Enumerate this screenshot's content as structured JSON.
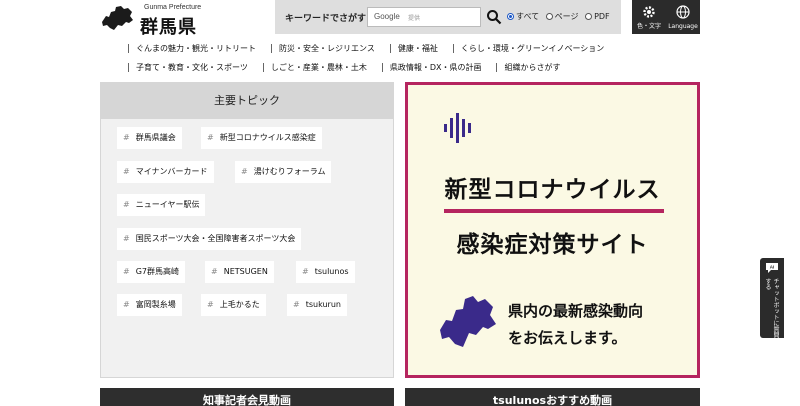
{
  "header": {
    "logo_en": "Gunma Prefecture",
    "logo_jp": "群馬県"
  },
  "search": {
    "label": "キーワードでさがす",
    "google": "Google",
    "placeholder": "提供",
    "options": [
      "すべて",
      "ページ",
      "PDF"
    ],
    "selected": "すべて"
  },
  "utility": {
    "color_text": "色・文字",
    "language": "Language"
  },
  "nav": {
    "row1": [
      "ぐんまの魅力・観光・リトリート",
      "防災・安全・レジリエンス",
      "健康・福祉",
      "くらし・環境・グリーンイノベーション"
    ],
    "row2": [
      "子育て・教育・文化・スポーツ",
      "しごと・産業・農林・土木",
      "県政情報・DX・県の計画",
      "組織からさがす"
    ]
  },
  "topics": {
    "title": "主要トピック",
    "hash": "#",
    "tags": [
      "群馬県議会",
      "新型コロナウイルス感染症",
      "マイナンバーカード",
      "湯けむりフォーラム",
      "ニューイヤー駅伝",
      "国民スポーツ大会・全国障害者スポーツ大会",
      "G7群馬高崎",
      "NETSUGEN",
      "tsulunos",
      "富岡製糸場",
      "上毛かるた",
      "tsukurun"
    ]
  },
  "banner": {
    "line1": "新型コロナウイルス",
    "line2": "感染症対策サイト",
    "msg1": "県内の最新感染動向",
    "msg2": "をお伝えします。",
    "accent": "#b5255f",
    "map_color": "#3a2a8a"
  },
  "bottom": {
    "left": "知事記者会見動画",
    "right": "tsulunosおすすめ動画"
  },
  "chat": {
    "badge": "AI",
    "label": "チャットボットに質問する"
  }
}
